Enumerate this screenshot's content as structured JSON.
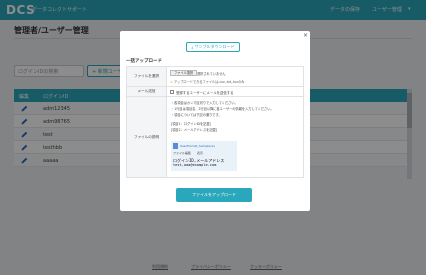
{
  "header": {
    "logo": "DCS",
    "app_name": "データコレクトサポート",
    "nav_save": "データの保存",
    "nav_user": "ユーザー管理",
    "nav_chevron": "▾"
  },
  "page": {
    "title": "管理者/ユーザー管理",
    "search_placeholder": "ログインIDの検索",
    "new_user_label": "+ 新規ユーザー"
  },
  "table": {
    "headers": [
      "編集",
      "ログインID"
    ],
    "rows": [
      "adm12345",
      "adm98765",
      "test",
      "testhbb",
      "aaaaa"
    ]
  },
  "footer": {
    "links": [
      "利用規約",
      "プライバシーポリシー",
      "クッキーポリシー"
    ]
  },
  "modal": {
    "close": "×",
    "sample_download": "サンプルダウンロード",
    "section_title": "一括アップロード",
    "file_label": "ファイルを選択",
    "file_button": "ファイル選択",
    "file_status": "選択されていません",
    "file_warning": "アップロードできるファイルは.csv,.txt,.tsvのみ",
    "mail_label": "メール送信",
    "mail_checkbox_label": "登録するユーザーにメールを送信する",
    "desc_label": "ファイルの説明",
    "desc_lines": [
      "・各項目はカンマ区切りで入力してください。",
      "・1行目は項目名、2行目以降に各ユーザーの情報を入力してください。",
      "・項目については下記の通りです。",
      "[項目1：ログインIDを記載]",
      "[項目2：メールアドレスを記載]"
    ],
    "sample_file_name": "UserFormat_Samplecsv",
    "sample_menu": [
      "ファイル",
      "編集",
      "表示"
    ],
    "sample_csv_header": "ログインID,メールアドレス",
    "sample_csv_row": "test,aaa@example.com",
    "upload_button": "ファイルをアップロード"
  },
  "colors": {
    "accent": "#2aa7bb",
    "overlay": "rgba(0,0,0,0.45)"
  }
}
